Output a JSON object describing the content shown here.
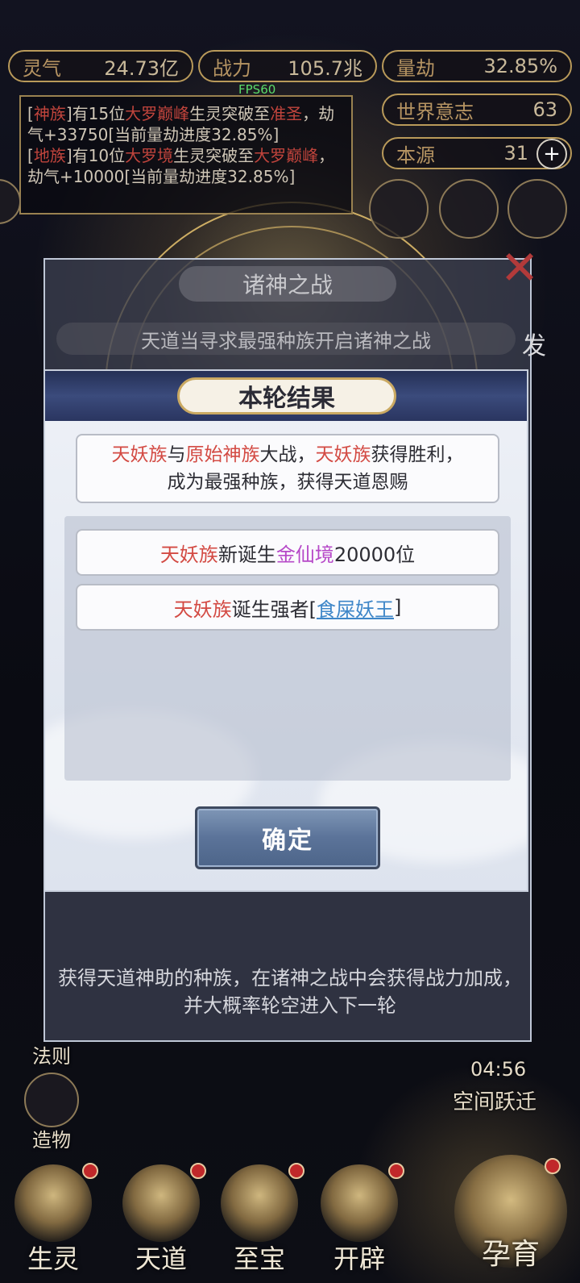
{
  "stats": {
    "lingqi": {
      "label": "灵气",
      "value": "24.73亿"
    },
    "zhanli": {
      "label": "战力",
      "value": "105.7兆"
    },
    "liangjie": {
      "label": "量劫",
      "value": "32.85%"
    },
    "shijie": {
      "label": "世界意志",
      "value": "63"
    },
    "benyuan": {
      "label": "本源",
      "value": "31"
    }
  },
  "fps": "FPS60",
  "log": {
    "line1_a": "[",
    "line1_race": "神族",
    "line1_b": "]有15位",
    "line1_rank": "大罗巅峰",
    "line1_c": "生灵突破至",
    "line1_target": "准圣",
    "line1_d": "，劫气+33750[当前量劫进度32.85%]",
    "line2_a": "[",
    "line2_race": "地族",
    "line2_b": "]有10位",
    "line2_rank": "大罗境",
    "line2_c": "生灵突破至",
    "line2_target": "大罗巅峰",
    "line2_d": "，劫气+10000[当前量劫进度32.85%]"
  },
  "back_dialog": {
    "title": "诸神之战",
    "subtitle": "天道当寻求最强种族开启诸神之战",
    "side_text": "发",
    "note": "获得天道神助的种族，在诸神之战中会获得战力加成，并大概率轮空进入下一轮"
  },
  "left_labels": {
    "fa_ze": "法则",
    "zao_wu": "造物"
  },
  "right_labels": {
    "timer": "04:56",
    "space_jump": "空间跃迁"
  },
  "bottom_nav": [
    "生灵",
    "天道",
    "至宝",
    "开辟",
    "孕育"
  ],
  "dialog": {
    "title": "本轮结果",
    "result_race1": "天妖族",
    "result_with": "与",
    "result_race2": "原始神族",
    "result_battle": "大战，",
    "result_race3": "天妖族",
    "result_win": "获得胜利，",
    "result_line2": "成为最强种族，获得天道恩赐",
    "items": [
      {
        "race": "天妖族",
        "text": "新诞生",
        "rank": "金仙境",
        "count": "20000位"
      },
      {
        "race": "天妖族",
        "text": "诞生强者[",
        "name": "食屎妖王",
        "end": "]"
      }
    ],
    "confirm": "确定"
  },
  "colors": {
    "accent_gold": "#b99a5a",
    "race_red": "#d34a43",
    "rank_purple": "#b648c8",
    "link_blue": "#3e86c8"
  }
}
